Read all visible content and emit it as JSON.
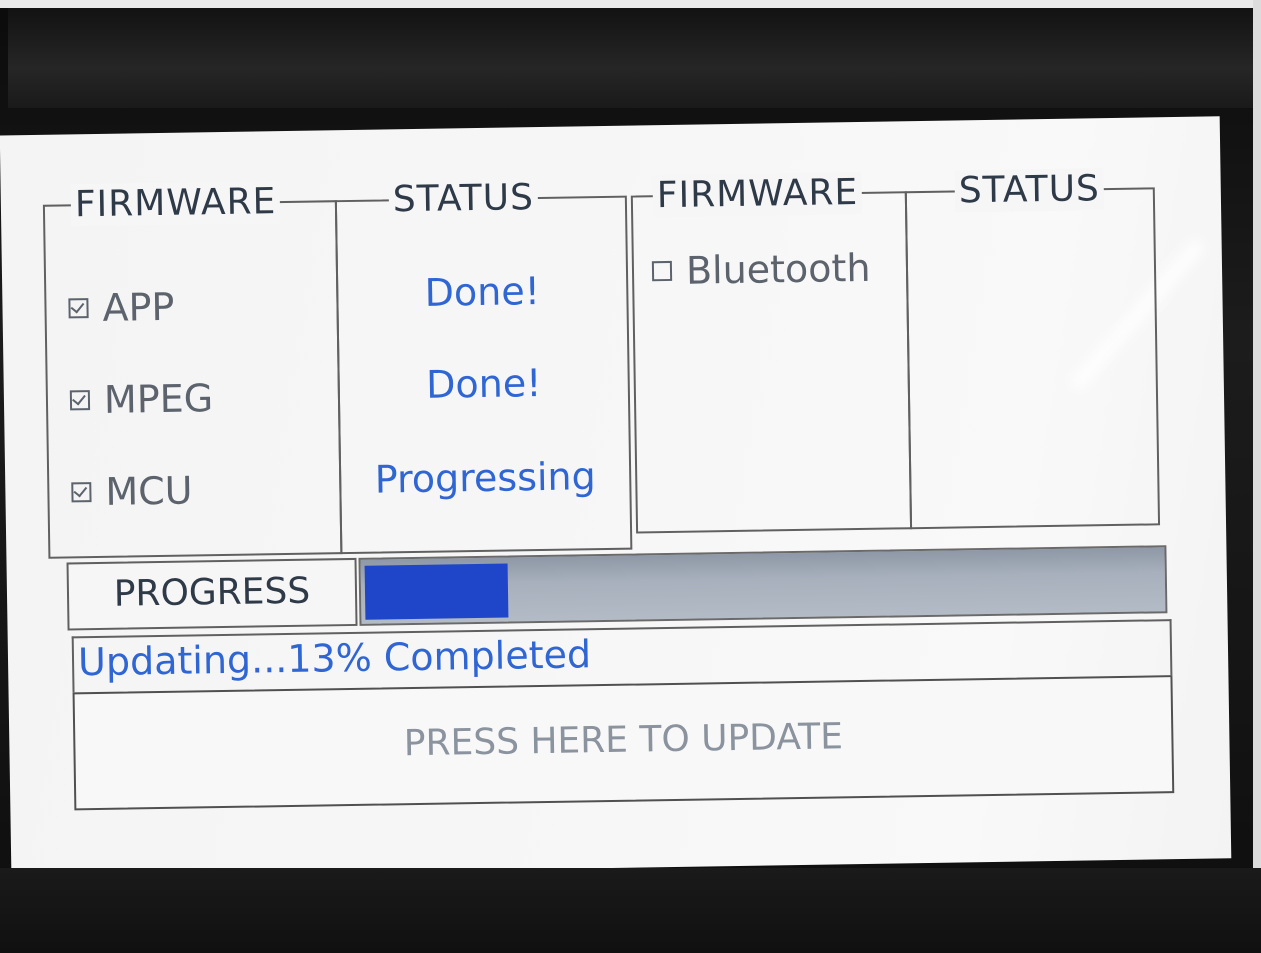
{
  "left_panel": {
    "firmware_title": "FIRMWARE",
    "status_title": "STATUS",
    "items": [
      {
        "name": "APP",
        "checked": true,
        "status": "Done!"
      },
      {
        "name": "MPEG",
        "checked": true,
        "status": "Done!"
      },
      {
        "name": "MCU",
        "checked": true,
        "status": "Progressing"
      }
    ]
  },
  "right_panel": {
    "firmware_title": "FIRMWARE",
    "status_title": "STATUS",
    "items": [
      {
        "name": "Bluetooth",
        "checked": false,
        "status": ""
      }
    ]
  },
  "progress": {
    "label": "PROGRESS",
    "percent": 13
  },
  "status_line": "Updating...13% Completed",
  "update_button_label": "PRESS HERE TO UPDATE",
  "colors": {
    "status_blue": "#2f66d4",
    "progress_fill": "#1f46c8",
    "progress_track": "#a7b0bc",
    "screen_bg": "#f6f6f6",
    "bezel": "#1a1a1a"
  }
}
